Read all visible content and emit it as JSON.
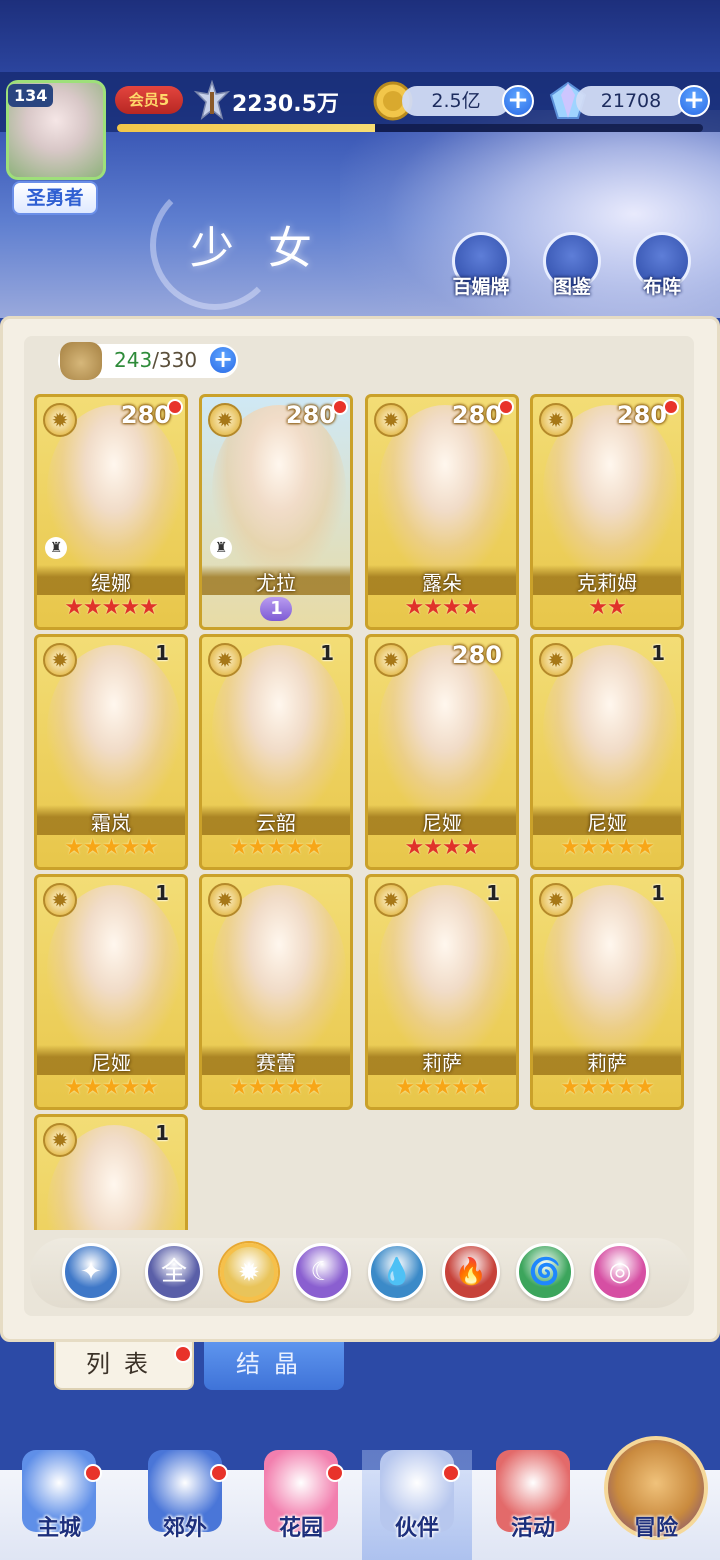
{
  "header": {
    "player_level": "134",
    "player_title": "圣勇者",
    "vip": "会员5",
    "power": "2230.5万",
    "exp_progress": 0.44,
    "gold": "2.5亿",
    "gems": "21708",
    "page_title": "少女",
    "buttons": [
      {
        "label": "百媚牌",
        "icon": "card-icon"
      },
      {
        "label": "图鉴",
        "icon": "book-icon"
      },
      {
        "label": "布阵",
        "icon": "grid-icon"
      }
    ]
  },
  "capacity": {
    "current": "243",
    "max": "/330"
  },
  "cards": [
    {
      "name": "缇娜",
      "level": "280",
      "stars": 5,
      "star_color": "red",
      "dot": true,
      "chess": true
    },
    {
      "name": "尤拉",
      "level": "280",
      "stars": 0,
      "star_color": "wing",
      "wing_badge": "1",
      "dot": true,
      "chess": true,
      "theme": "blue"
    },
    {
      "name": "露朵",
      "level": "280",
      "stars": 4,
      "star_color": "red",
      "dot": true
    },
    {
      "name": "克莉姆",
      "level": "280",
      "stars": 2,
      "star_color": "red",
      "dot": true
    },
    {
      "name": "霜岚",
      "level": "1",
      "stars": 5,
      "star_color": "gold"
    },
    {
      "name": "云韶",
      "level": "1",
      "stars": 5,
      "star_color": "gold"
    },
    {
      "name": "尼娅",
      "level": "280",
      "stars": 4,
      "star_color": "red"
    },
    {
      "name": "尼娅",
      "level": "1",
      "stars": 5,
      "star_color": "gold"
    },
    {
      "name": "尼娅",
      "level": "1",
      "stars": 5,
      "star_color": "gold"
    },
    {
      "name": "赛蕾",
      "level": "",
      "stars": 5,
      "star_color": "gold"
    },
    {
      "name": "莉萨",
      "level": "1",
      "stars": 5,
      "star_color": "gold"
    },
    {
      "name": "莉萨",
      "level": "1",
      "stars": 5,
      "star_color": "gold"
    },
    {
      "name": "",
      "level": "1",
      "stars": 0,
      "star_color": "gold"
    }
  ],
  "filters": [
    {
      "name": "filter-rarity-icon",
      "glyph": "✦",
      "color": "#3f78c8",
      "selected": false
    },
    {
      "name": "filter-all",
      "glyph": "全",
      "color": "#5a5fa8",
      "selected": false
    },
    {
      "name": "filter-light-icon",
      "glyph": "✹",
      "color": "#e9c45a",
      "selected": true
    },
    {
      "name": "filter-moon-icon",
      "glyph": "☾",
      "color": "#8a5fd0",
      "selected": false
    },
    {
      "name": "filter-water-icon",
      "glyph": "💧",
      "color": "#3b8ac8",
      "selected": false
    },
    {
      "name": "filter-fire-icon",
      "glyph": "🔥",
      "color": "#c7423a",
      "selected": false
    },
    {
      "name": "filter-wind-icon",
      "glyph": "🌀",
      "color": "#3ca55c",
      "selected": false
    },
    {
      "name": "filter-orbit-icon",
      "glyph": "◎",
      "color": "#d64fa3",
      "selected": false
    }
  ],
  "tabs": {
    "list": "列表",
    "crystal": "结晶"
  },
  "nav": [
    {
      "label": "主城",
      "icon": "castle-icon",
      "dot": true
    },
    {
      "label": "郊外",
      "icon": "portal-icon",
      "dot": true
    },
    {
      "label": "花园",
      "icon": "heart-icon",
      "dot": true
    },
    {
      "label": "伙伴",
      "icon": "partner-icon",
      "dot": true,
      "active": true
    },
    {
      "label": "活动",
      "icon": "gift-icon",
      "dot": false
    },
    {
      "label": "冒险",
      "icon": "compass-icon",
      "dot": false
    }
  ],
  "colors": {
    "accent": "#2c4aa6",
    "gold_card": "#e8c64a",
    "red_dot": "#e8332a"
  }
}
